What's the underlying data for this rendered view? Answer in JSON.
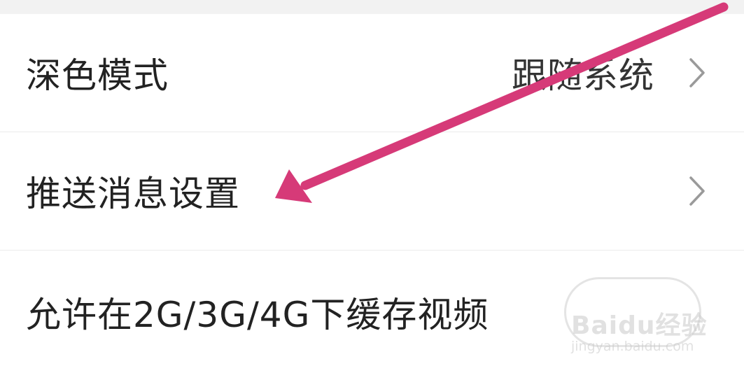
{
  "settings": {
    "dark_mode": {
      "label": "深色模式",
      "value": "跟随系统"
    },
    "push_settings": {
      "label": "推送消息设置"
    },
    "cache_video": {
      "label": "允许在2G/3G/4G下缓存视频",
      "enabled": false
    }
  },
  "watermark": {
    "brand": "Baidu经验",
    "url": "jingyan.baidu.com"
  },
  "colors": {
    "annotation_arrow": "#d63a78",
    "chevron": "#9a9a9a",
    "divider": "#ebebeb"
  }
}
